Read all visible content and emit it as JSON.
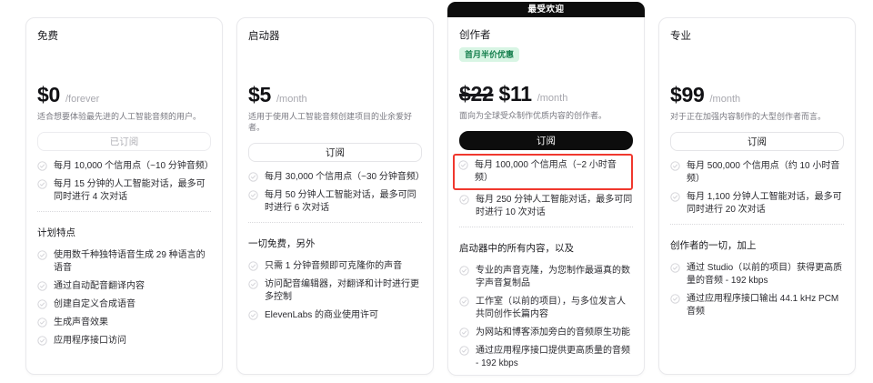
{
  "colors": {
    "accent_black": "#0d0d0d",
    "promo_badge_bg": "#d8f5e4",
    "promo_badge_text": "#157f4d",
    "highlight_red": "#f0382e"
  },
  "plans": [
    {
      "name": "免费",
      "price": "$0",
      "period": "/forever",
      "description": "适合想要体验最先进的人工智能音频的用户。",
      "button_label": "已订阅",
      "usage": [
        "每月 10,000 个信用点（~10 分钟音频）",
        "每月 15 分钟的人工智能对话，最多可同时进行 4 次对话"
      ],
      "section_title": "计划特点",
      "features": [
        "使用数千种独特语音生成 29 种语言的语音",
        "通过自动配音翻译内容",
        "创建自定义合成语音",
        "生成声音效果",
        "应用程序接口访问"
      ]
    },
    {
      "name": "启动器",
      "price": "$5",
      "period": "/month",
      "description": "适用于使用人工智能音频创建项目的业余爱好者。",
      "button_label": "订阅",
      "usage": [
        "每月 30,000 个信用点（~30 分钟音频）",
        "每月 50 分钟人工智能对话，最多可同时进行 6 次对话"
      ],
      "section_title": "一切免费，另外",
      "features": [
        "只需 1 分钟音频即可克隆你的声音",
        "访问配音编辑器，对翻译和计时进行更多控制",
        "ElevenLabs 的商业使用许可"
      ]
    },
    {
      "name": "创作者",
      "popular_badge": "最受欢迎",
      "promo_badge": "首月半价优惠",
      "old_price": "$22",
      "price": "$11",
      "period": "/month",
      "description": "面向为全球受众制作优质内容的创作者。",
      "button_label": "订阅",
      "usage": [
        "每月 100,000 个信用点（~2 小时音频）",
        "每月 250 分钟人工智能对话，最多可同时进行 10 次对话"
      ],
      "section_title": "启动器中的所有内容，以及",
      "features": [
        "专业的声音克隆，为您制作最逼真的数字声音复制品",
        "工作室（以前的项目），与多位发言人共同创作长篇内容",
        "为网站和博客添加旁白的音频原生功能",
        "通过应用程序接口提供更高质量的音频 - 192 kbps"
      ]
    },
    {
      "name": "专业",
      "price": "$99",
      "period": "/month",
      "description": "对于正在加强内容制作的大型创作者而言。",
      "button_label": "订阅",
      "usage": [
        "每月 500,000 个信用点（约 10 小时音频）",
        "每月 1,100 分钟人工智能对话，最多可同时进行 20 次对话"
      ],
      "section_title": "创作者的一切，加上",
      "features": [
        "通过 Studio（以前的项目）获得更高质量的音频 - 192 kbps",
        "通过应用程序接口输出 44.1 kHz PCM 音频"
      ]
    }
  ]
}
